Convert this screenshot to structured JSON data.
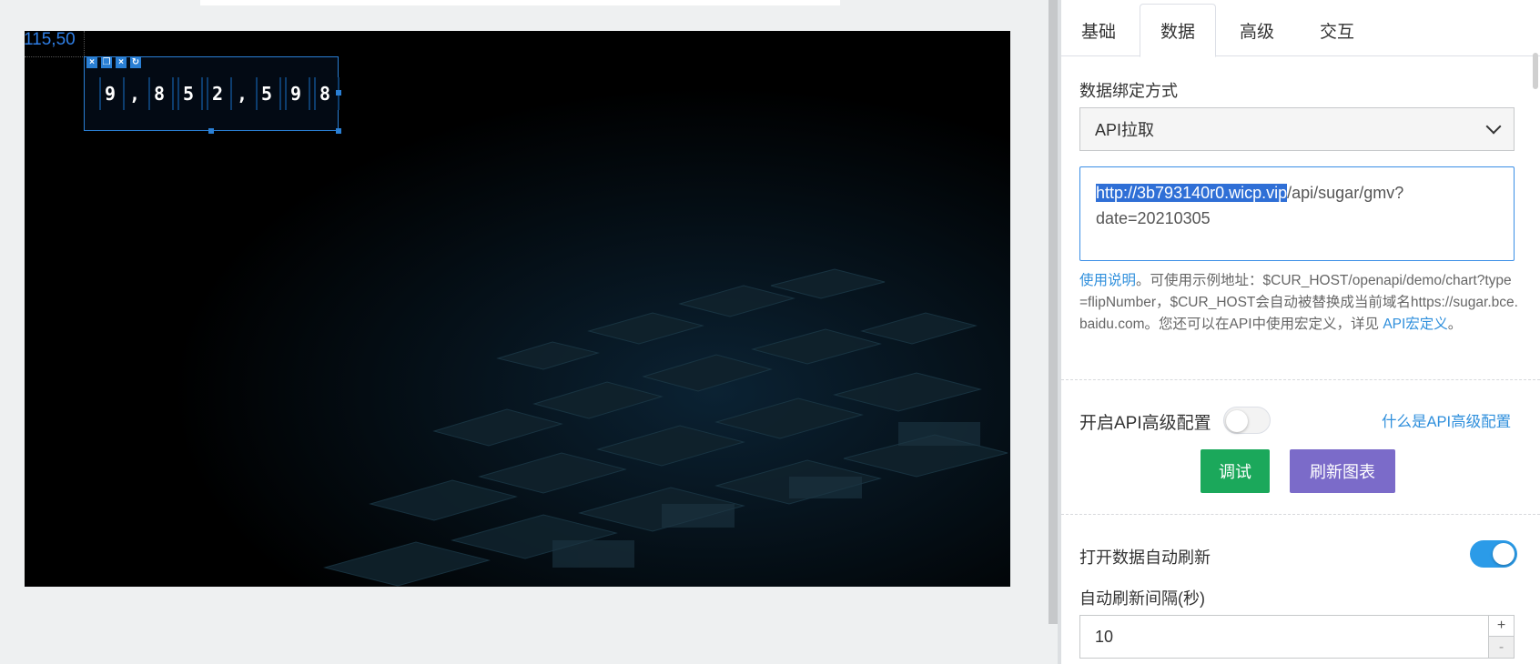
{
  "canvas": {
    "coordinate_readout": "115,50",
    "widget": {
      "digits": [
        "9",
        ",",
        "8",
        "5",
        "2",
        ",",
        "5",
        "9",
        "8"
      ],
      "toolbar_icons": [
        "close-icon",
        "copy-icon",
        "delete-icon",
        "refresh-icon"
      ]
    }
  },
  "panel": {
    "tabs": [
      {
        "label": "基础",
        "active": false
      },
      {
        "label": "数据",
        "active": true
      },
      {
        "label": "高级",
        "active": false
      },
      {
        "label": "交互",
        "active": false
      }
    ],
    "binding_label": "数据绑定方式",
    "binding_select_value": "API拉取",
    "api_url_selected": "http://3b793140r0.wicp.vip",
    "api_url_rest": "/api/sugar/gmv?date=20210305",
    "help": {
      "link1": "使用说明",
      "text": "。可使用示例地址：$CUR_HOST/openapi/demo/chart?type=flipNumber，$CUR_HOST会自动被替换成当前域名https://sugar.bce.baidu.com。您还可以在API中使用宏定义，详见 ",
      "link2": "API宏定义",
      "tail": "。"
    },
    "advanced_config_label": "开启API高级配置",
    "advanced_config_on": false,
    "what_is_advanced": "什么是API高级配置",
    "debug_button": "调试",
    "refresh_button": "刷新图表",
    "auto_refresh_label": "打开数据自动刷新",
    "auto_refresh_on": true,
    "interval_label": "自动刷新间隔(秒)",
    "interval_value": "10",
    "stepper_plus": "+",
    "stepper_minus": "-"
  },
  "colors": {
    "accent_blue": "#2b9be8",
    "debug_green": "#1ba85b",
    "refresh_purple": "#7b6bc9",
    "link_blue": "#2f8fdc"
  }
}
